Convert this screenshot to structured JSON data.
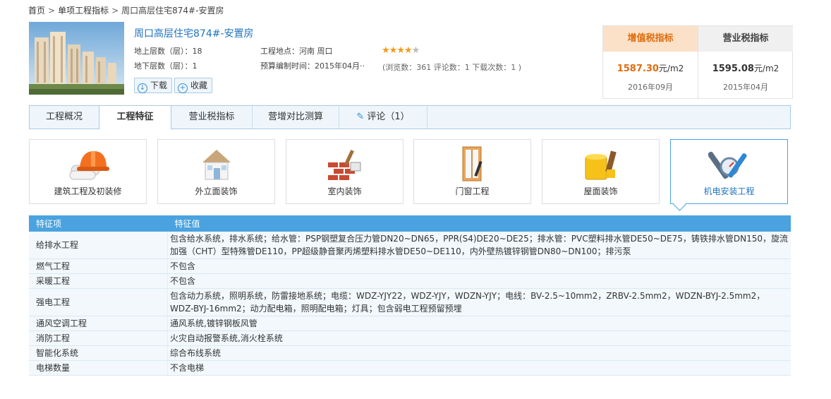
{
  "breadcrumb": {
    "home": "首页",
    "sep": ">",
    "section": "单项工程指标",
    "current": "周口高层住宅874#-安置房"
  },
  "project": {
    "title": "周口高层住宅874#-安置房",
    "above_floors": "地上层数（层）：18",
    "below_floors": "地下层数（层）：1",
    "location": "工程地点：河南  周口",
    "budget_time_label": "预算编制时间：",
    "budget_time_value": "2015年04月",
    "rating": 4,
    "stats": "(浏览数：361  评论数：1  下载次数：1  )",
    "download_label": "下载",
    "favorite_label": "收藏"
  },
  "tax": {
    "vat": {
      "title": "增值税指标",
      "value": "1587.30",
      "unit": "元/m2",
      "date": "2016年09月"
    },
    "business": {
      "title": "营业税指标",
      "value": "1595.08",
      "unit": "元/m2",
      "date": "2015年04月"
    }
  },
  "tabs": [
    "工程概况",
    "工程特征",
    "营业税指标",
    "营增对比测算",
    "评论（1）"
  ],
  "categories": [
    {
      "label": "建筑工程及初装修",
      "icon": "hardhat-blueprint-icon"
    },
    {
      "label": "外立面装饰",
      "icon": "house-icon"
    },
    {
      "label": "室内装饰",
      "icon": "brick-paint-icon"
    },
    {
      "label": "门窗工程",
      "icon": "door-icon"
    },
    {
      "label": "屋面装饰",
      "icon": "paint-bucket-icon"
    },
    {
      "label": "机电安装工程",
      "icon": "wrench-gauge-icon"
    }
  ],
  "table": {
    "headers": [
      "特征项",
      "特征值"
    ],
    "rows": [
      {
        "item": "给排水工程",
        "value": "包含给水系统，排水系统；给水管：PSP钢塑复合压力管DN20~DN65，PPR(S4)DE20~DE25；排水管：PVC塑料排水管DE50~DE75，铸铁排水管DN150，旋流加强（CHT）型特殊管DE110，PP超级静音聚丙烯塑料排水管DE50~DE110，内外壁热镀锌钢管DN80~DN100；排污泵"
      },
      {
        "item": "燃气工程",
        "value": "不包含"
      },
      {
        "item": "采暖工程",
        "value": "不包含"
      },
      {
        "item": "强电工程",
        "value": "包含动力系统，照明系统，防雷接地系统；电缆：WDZ-YJY22，WDZ-YJY，WDZN-YJY；电线：BV-2.5~10mm2，ZRBV-2.5mm2，WDZN-BYJ-2.5mm2，WDZ-BYJ-16mm2；动力配电箱，照明配电箱；灯具；包含弱电工程预留预埋"
      },
      {
        "item": "通风空调工程",
        "value": "通风系统,镀锌钢板风管"
      },
      {
        "item": "消防工程",
        "value": "火灾自动报警系统,消火栓系统"
      },
      {
        "item": "智能化系统",
        "value": "综合布线系统"
      },
      {
        "item": "电梯数量",
        "value": "不含电梯"
      }
    ]
  },
  "colors": {
    "accent": "#4aa3df",
    "link": "#1e73be",
    "orange": "#e06b0c"
  }
}
